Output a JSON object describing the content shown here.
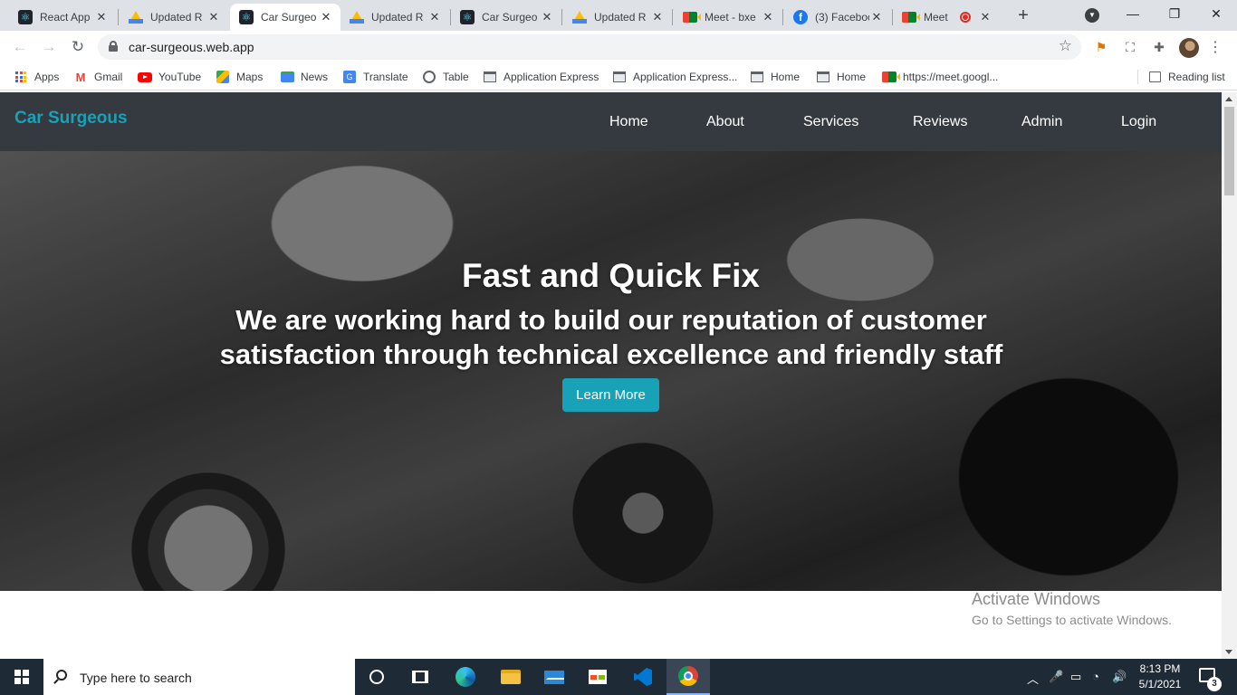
{
  "browser": {
    "tabs": [
      {
        "label": "React App",
        "icon": "react-icon",
        "active": false
      },
      {
        "label": "Updated R",
        "icon": "google-drive-icon",
        "active": false
      },
      {
        "label": "Car Surgeo",
        "icon": "react-icon",
        "active": true
      },
      {
        "label": "Updated R",
        "icon": "google-drive-icon",
        "active": false
      },
      {
        "label": "Car Surgeo",
        "icon": "react-icon",
        "active": false
      },
      {
        "label": "Updated R",
        "icon": "google-drive-icon",
        "active": false
      },
      {
        "label": "Meet - bxe",
        "icon": "google-meet-icon",
        "active": false
      },
      {
        "label": "(3) Faceboo",
        "icon": "facebook-icon",
        "active": false
      },
      {
        "label": "Meet",
        "icon": "google-meet-icon",
        "active": false,
        "recording": true
      }
    ],
    "tab_close_glyph": "✕",
    "new_tab_glyph": "+",
    "window_controls": {
      "minimize": "—",
      "restore": "❐",
      "close": "✕"
    },
    "url": "car-surgeous.web.app",
    "bookmarks": [
      {
        "label": "Apps",
        "icon": "apps-grid-icon"
      },
      {
        "label": "Gmail",
        "icon": "gmail-icon"
      },
      {
        "label": "YouTube",
        "icon": "youtube-icon"
      },
      {
        "label": "Maps",
        "icon": "maps-icon"
      },
      {
        "label": "News",
        "icon": "news-icon"
      },
      {
        "label": "Translate",
        "icon": "translate-icon"
      },
      {
        "label": "Table",
        "icon": "globe-icon"
      },
      {
        "label": "Application Express",
        "icon": "page-icon"
      },
      {
        "label": "Application Express...",
        "icon": "page-icon"
      },
      {
        "label": "Home",
        "icon": "page-icon"
      },
      {
        "label": "Home",
        "icon": "page-icon"
      },
      {
        "label": "https://meet.googl...",
        "icon": "google-meet-icon"
      }
    ],
    "reading_list": "Reading list"
  },
  "site": {
    "brand": "Car Surgeous",
    "nav": [
      "Home",
      "About",
      "Services",
      "Reviews",
      "Admin",
      "Login"
    ],
    "hero": {
      "title": "Fast and Quick Fix",
      "subtitle": "We are working hard to build our reputation of customer satisfaction through technical excellence and friendly staff",
      "button": "Learn More"
    },
    "colors": {
      "navbar": "#343a40",
      "brand": "#17a2b8",
      "button": "#17a2b8"
    }
  },
  "watermark": {
    "line1": "Activate Windows",
    "line2": "Go to Settings to activate Windows."
  },
  "taskbar": {
    "search_placeholder": "Type here to search",
    "time": "8:13 PM",
    "date": "5/1/2021",
    "notification_count": "3"
  }
}
